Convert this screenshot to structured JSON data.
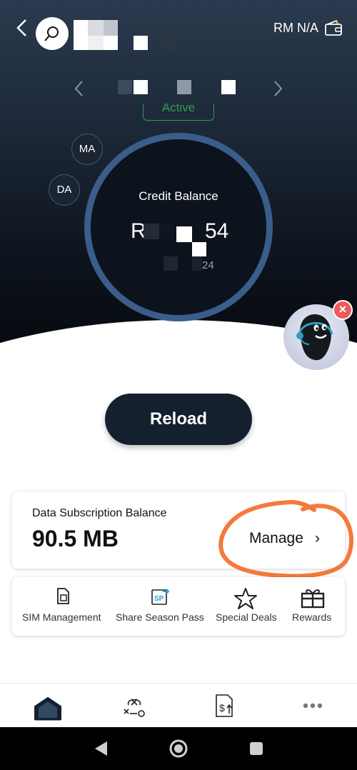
{
  "header": {
    "balance_label": "RM N/A",
    "wallet_icon": "wallet-icon",
    "back_icon": "back-arrow-icon",
    "search_icon": "search-icon"
  },
  "account": {
    "status": "Active",
    "prev_icon": "chevron-left-icon",
    "next_icon": "chevron-right-icon"
  },
  "tags": {
    "ma": "MA",
    "da": "DA"
  },
  "credit": {
    "label": "Credit Balance",
    "amount_prefix": "R",
    "amount_suffix": "54",
    "sub": "24",
    "ring_color": "#3a5d8a"
  },
  "mascot": {
    "icon": "support-mascot-icon",
    "close_icon": "close-icon"
  },
  "reload": {
    "label": "Reload"
  },
  "data_card": {
    "title": "Data Subscription Balance",
    "value": "90.5 MB",
    "manage_label": "Manage",
    "manage_chevron": "›",
    "annotation_color": "#f47a3c"
  },
  "quick_actions": [
    {
      "label": "SIM Management",
      "icon": "sim-card-icon"
    },
    {
      "label": "Share Season Pass",
      "icon": "share-pass-icon"
    },
    {
      "label": "Special Deals",
      "icon": "star-icon"
    },
    {
      "label": "Rewards",
      "icon": "gift-icon"
    }
  ],
  "bottom_nav": [
    {
      "name": "home",
      "icon": "home-icon"
    },
    {
      "name": "plans",
      "icon": "plans-icon"
    },
    {
      "name": "billing",
      "icon": "bill-icon"
    },
    {
      "name": "more",
      "icon": "more-icon"
    }
  ],
  "system_nav": [
    {
      "name": "back",
      "icon": "system-back-icon"
    },
    {
      "name": "home",
      "icon": "system-home-icon"
    },
    {
      "name": "recents",
      "icon": "system-recents-icon"
    }
  ]
}
